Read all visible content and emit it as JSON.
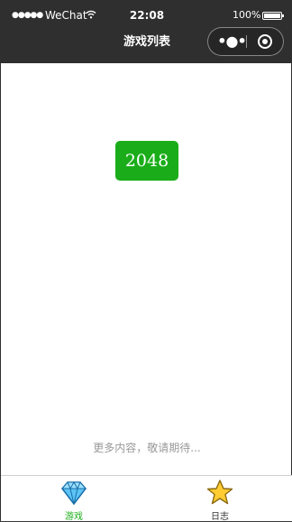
{
  "status_bar": {
    "signal": "●●●●●",
    "carrier": "WeChat",
    "wifi_icon": "wifi-icon",
    "time": "22:08",
    "battery_percent": "100%",
    "battery_level": 1.0
  },
  "nav": {
    "title": "游戏列表",
    "more_icon": "more-dots-icon",
    "close_icon": "target-circle-icon"
  },
  "main": {
    "game_button_label": "2048",
    "footer_note": "更多内容，敬请期待..."
  },
  "tabbar": {
    "items": [
      {
        "label": "游戏",
        "icon": "diamond-icon",
        "active": true,
        "color": "#1aad19"
      },
      {
        "label": "日志",
        "icon": "star-icon",
        "active": false,
        "color": "#333333"
      }
    ]
  },
  "colors": {
    "accent": "#1aad19",
    "topbar": "#2f2f2f",
    "muted_text": "#999999"
  }
}
